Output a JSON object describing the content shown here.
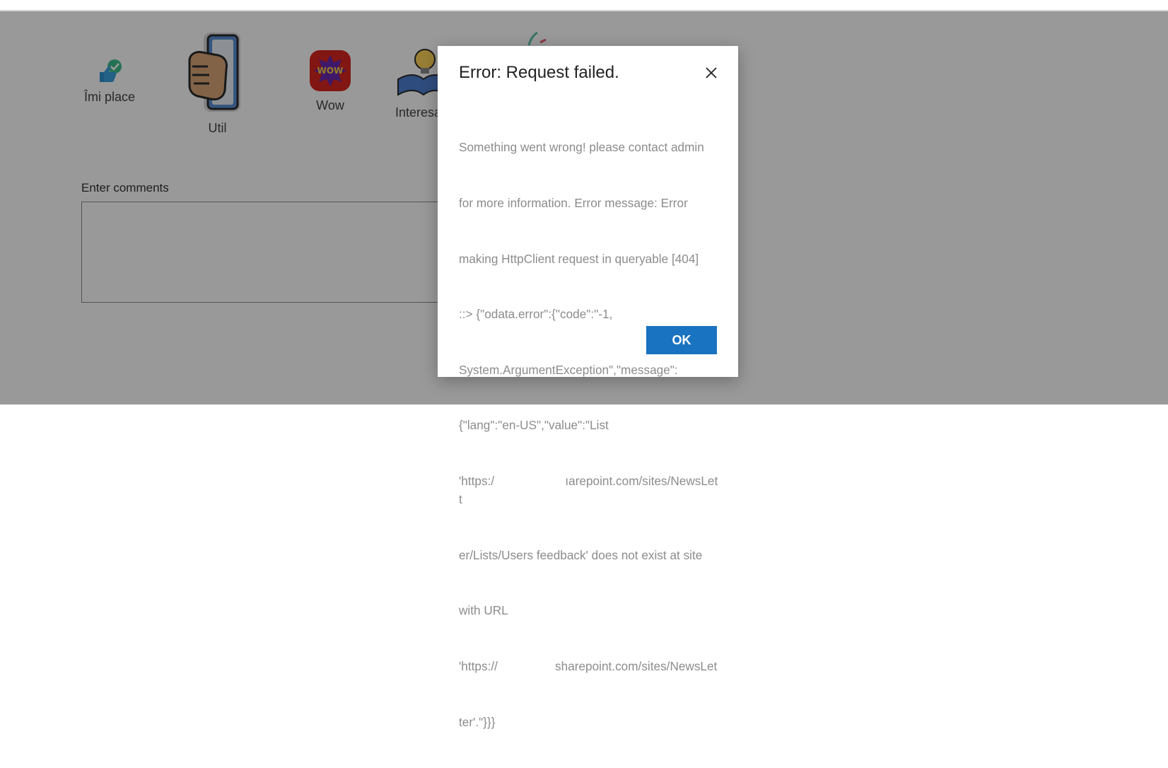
{
  "reactions": [
    {
      "label": "Îmi place",
      "icon": "thumbs-up-check-icon"
    },
    {
      "label": "Util",
      "icon": "handshake-phone-icon"
    },
    {
      "label": "Wow",
      "icon": "wow-badge-icon",
      "badge_text": "WOW"
    },
    {
      "label": "Interesa",
      "icon": "book-lightbulb-icon"
    }
  ],
  "comments": {
    "label": "Enter comments",
    "value": ""
  },
  "dialog": {
    "title": "Error: Request failed.",
    "message_lines": [
      "Something went wrong! please contact admin",
      "for more information. Error message: Error",
      "making HttpClient request in queryable [404]",
      "::> {\"odata.error\":{\"code\":\"-1,",
      "System.ArgumentException\",\"message\":",
      "{\"lang\":\"en-US\",\"value\":\"List",
      "'https:/                     ıarepoint.com/sites/NewsLett",
      "er/Lists/Users feedback' does not exist at site",
      "with URL",
      "'https://                 sharepoint.com/sites/NewsLet",
      "ter'.\"}}}"
    ],
    "ok_label": "OK"
  },
  "colors": {
    "accent": "#1a73c0",
    "overlay": "rgba(0,0,0,0.40)",
    "body_text": "#8c8c8c"
  }
}
